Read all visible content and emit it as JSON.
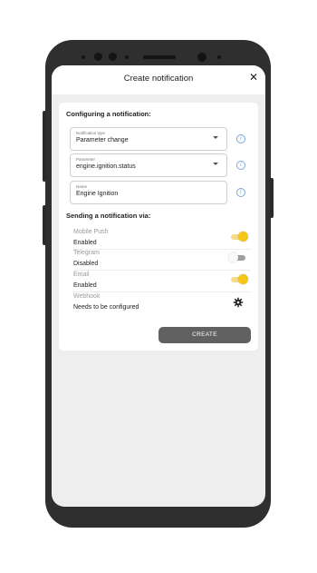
{
  "header": {
    "title": "Create notification",
    "close_glyph": "✕"
  },
  "configure": {
    "title": "Configuring a notification:",
    "fields": [
      {
        "label": "Notification type",
        "value": "Parameter change"
      },
      {
        "label": "Parameter",
        "value": "engine.ignition.status"
      },
      {
        "label": "Name",
        "value": "Engine Ignition"
      }
    ],
    "info_glyph": "i"
  },
  "sending": {
    "title": "Sending a notification via:",
    "channels": [
      {
        "name": "Mobile Push",
        "status": "Enabled",
        "state": "on"
      },
      {
        "name": "Telegram",
        "status": "Disabled",
        "state": "off"
      },
      {
        "name": "Email",
        "status": "Enabled",
        "state": "on"
      },
      {
        "name": "Webhook",
        "status": "Needs to be configured",
        "state": "configure"
      }
    ]
  },
  "actions": {
    "create_label": "CREATE"
  },
  "colors": {
    "accent": "#f5c518",
    "button": "#616161",
    "info": "#7aa7d8",
    "frame": "#2f2f2f"
  },
  "icons": {
    "close": "close-icon",
    "info": "info-icon",
    "dropdown": "chevron-down-icon",
    "webhook": "cog-icon"
  }
}
